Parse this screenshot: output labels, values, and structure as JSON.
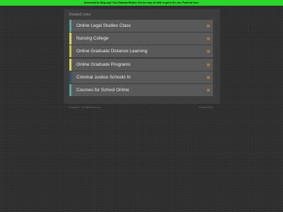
{
  "banner": {
    "text": "Interested in chep.org? Our Domain Broker Service may be able to get it for you. Find out how.",
    "color": "#2bd62b"
  },
  "panel": {
    "title": "Related Links"
  },
  "links": [
    {
      "label": "Online Legal Studies Class",
      "accent": "#5ba3a0",
      "arrow": "»"
    },
    {
      "label": "Nursing College",
      "accent": "#d8d45a",
      "arrow": "»"
    },
    {
      "label": "Online Graduate Distance Learning",
      "accent": "#c9c24a",
      "arrow": "»"
    },
    {
      "label": "Online Graduate Programs",
      "accent": "#d8d45a",
      "arrow": "»"
    },
    {
      "label": "Criminal Justice Schools In",
      "accent": "#2f4f73",
      "arrow": "»"
    },
    {
      "label": "Courses for School Online",
      "accent": "#5ba3a0",
      "arrow": "»"
    }
  ],
  "footer": {
    "copyright": "Copyright © . All rights reserved.",
    "privacy": "Privacy Policy"
  },
  "colors": {
    "background": "#2b2b2b",
    "panel": "#3d3d3d",
    "link_bg": "#595959",
    "arrow": "#e0903a"
  }
}
